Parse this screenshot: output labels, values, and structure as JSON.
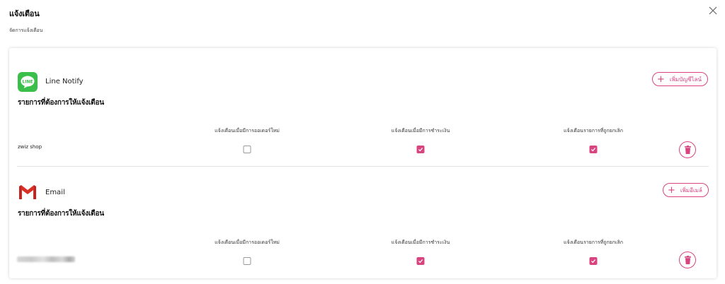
{
  "dialog": {
    "title": "แจ้งเตือน",
    "subtitle": "จัดการแจ้งเตือน"
  },
  "colors": {
    "accent": "#d9437f",
    "line_green": "#3ac04a",
    "gmail_red": "#d93025"
  },
  "columns": [
    "แจ้งเตือนเมื่อมีการออเดอร์ใหม่",
    "แจ้งเตือนเมื่อมีการชำระเงิน",
    "แจ้งเตือนรายการที่ถูกยกเลิก"
  ],
  "line": {
    "service_name": "Line Notify",
    "logo_text": "LINE",
    "section_title": "รายการที่ต้องการให้แจ้งเตือน",
    "add_button_label": "เพิ่มบัญชีไลน์",
    "rows": [
      {
        "name": "zwiz shop",
        "new_order": false,
        "payment": true,
        "cancelled": true
      }
    ]
  },
  "email": {
    "service_name": "Email",
    "section_title": "รายการที่ต้องการให้แจ้งเตือน",
    "add_button_label": "เพิ่มอีเมล์",
    "rows": [
      {
        "name": "",
        "new_order": false,
        "payment": true,
        "cancelled": true
      }
    ]
  }
}
